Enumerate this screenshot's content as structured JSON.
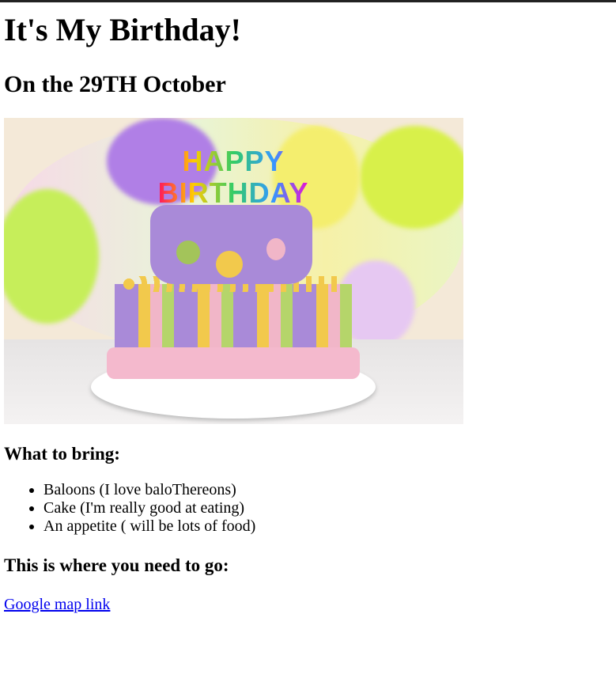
{
  "title": "It's My Birthday!",
  "subtitle": "On the 29TH October",
  "image": {
    "alt": "Birthday cake",
    "cake_text": "HAPPY BIRTHDAY"
  },
  "bring": {
    "heading": "What to bring:",
    "items": [
      "Baloons (I love baloThereons)",
      "Cake (I'm really good at eating)",
      "An appetite ( will be lots of food)"
    ]
  },
  "location": {
    "heading": "This is where you need to go:",
    "link": "Google map link"
  }
}
